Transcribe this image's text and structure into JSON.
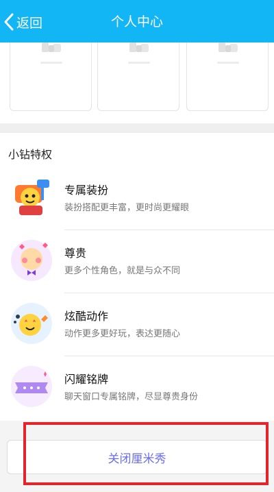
{
  "header": {
    "back_label": "返回",
    "title": "个人中心",
    "background_color": "#13b6f5"
  },
  "top_cards": [
    {
      "icon": "placeholder-image-icon"
    },
    {
      "icon": "placeholder-image-icon"
    },
    {
      "icon": "placeholder-image-icon"
    }
  ],
  "section": {
    "title": "小钻特权",
    "items": [
      {
        "title": "专属装扮",
        "desc": "装扮搭配更丰富，更时尚更耀眼",
        "icon": "paint-roller-character-icon"
      },
      {
        "title": "尊贵",
        "desc": "更多个性角色，就是与众不同",
        "icon": "bowtie-character-icon"
      },
      {
        "title": "炫酷动作",
        "desc": "动作更多更好玩，表达更随心",
        "icon": "star-eyes-character-icon"
      },
      {
        "title": "闪耀铭牌",
        "desc": "聊天窗口专属铭牌，尽显尊贵身份",
        "icon": "nameplate-icon"
      }
    ]
  },
  "bottom": {
    "close_button_label": "关闭厘米秀",
    "highlight_color": "#e3242b"
  }
}
